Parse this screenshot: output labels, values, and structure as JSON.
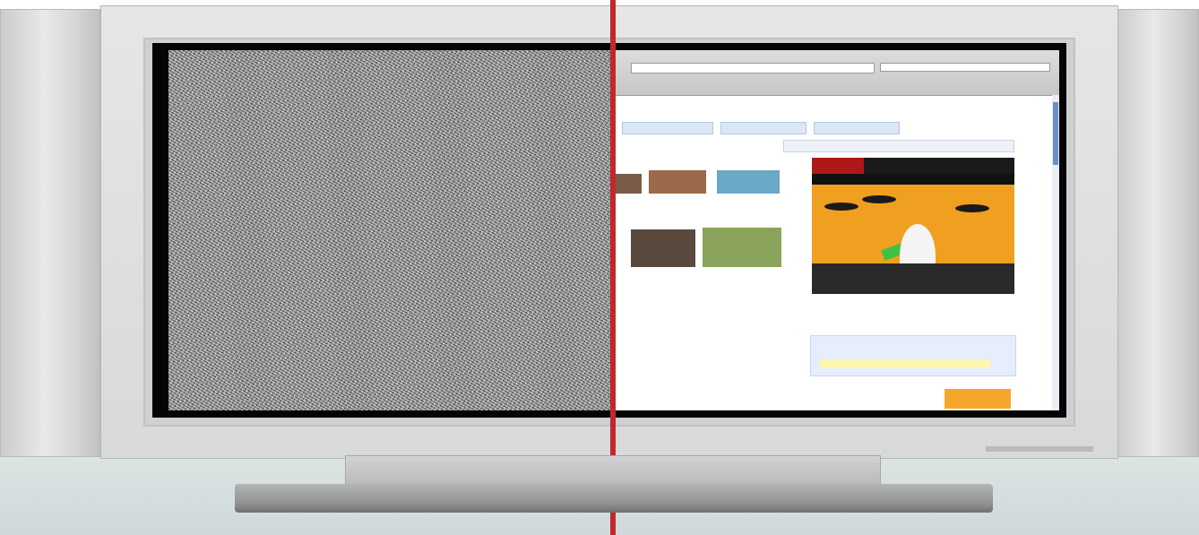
{
  "scene": {
    "subject": "flat-panel-tv",
    "split_line_color": "#c0282b"
  },
  "left_screen": {
    "content": "static-noise"
  },
  "right_screen": {
    "content": "web-page",
    "accent_color": "#2a58b7",
    "ad_accent_color": "#f0a020"
  }
}
